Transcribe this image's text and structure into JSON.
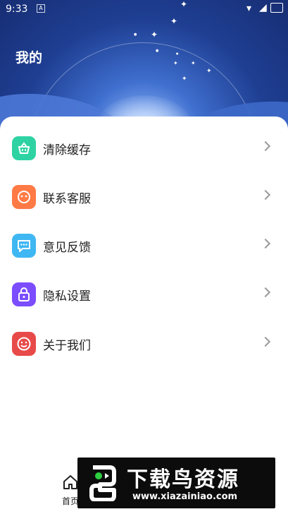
{
  "status_bar": {
    "time": "9:33",
    "notification_icon": "A"
  },
  "header": {
    "title": "我的"
  },
  "menu": {
    "items": [
      {
        "label": "清除缓存",
        "icon": "basket-icon",
        "color": "#2fd3a3"
      },
      {
        "label": "联系客服",
        "icon": "service-face-icon",
        "color": "#ff7a45"
      },
      {
        "label": "意见反馈",
        "icon": "chat-icon",
        "color": "#3fb7f2"
      },
      {
        "label": "隐私设置",
        "icon": "lock-icon",
        "color": "#7b4dff"
      },
      {
        "label": "关于我们",
        "icon": "smile-icon",
        "color": "#e84a4a"
      }
    ]
  },
  "bottom_nav": {
    "home_label": "首页"
  },
  "watermark": {
    "title": "下载鸟资源",
    "url": "www.xiazainiao.com"
  }
}
